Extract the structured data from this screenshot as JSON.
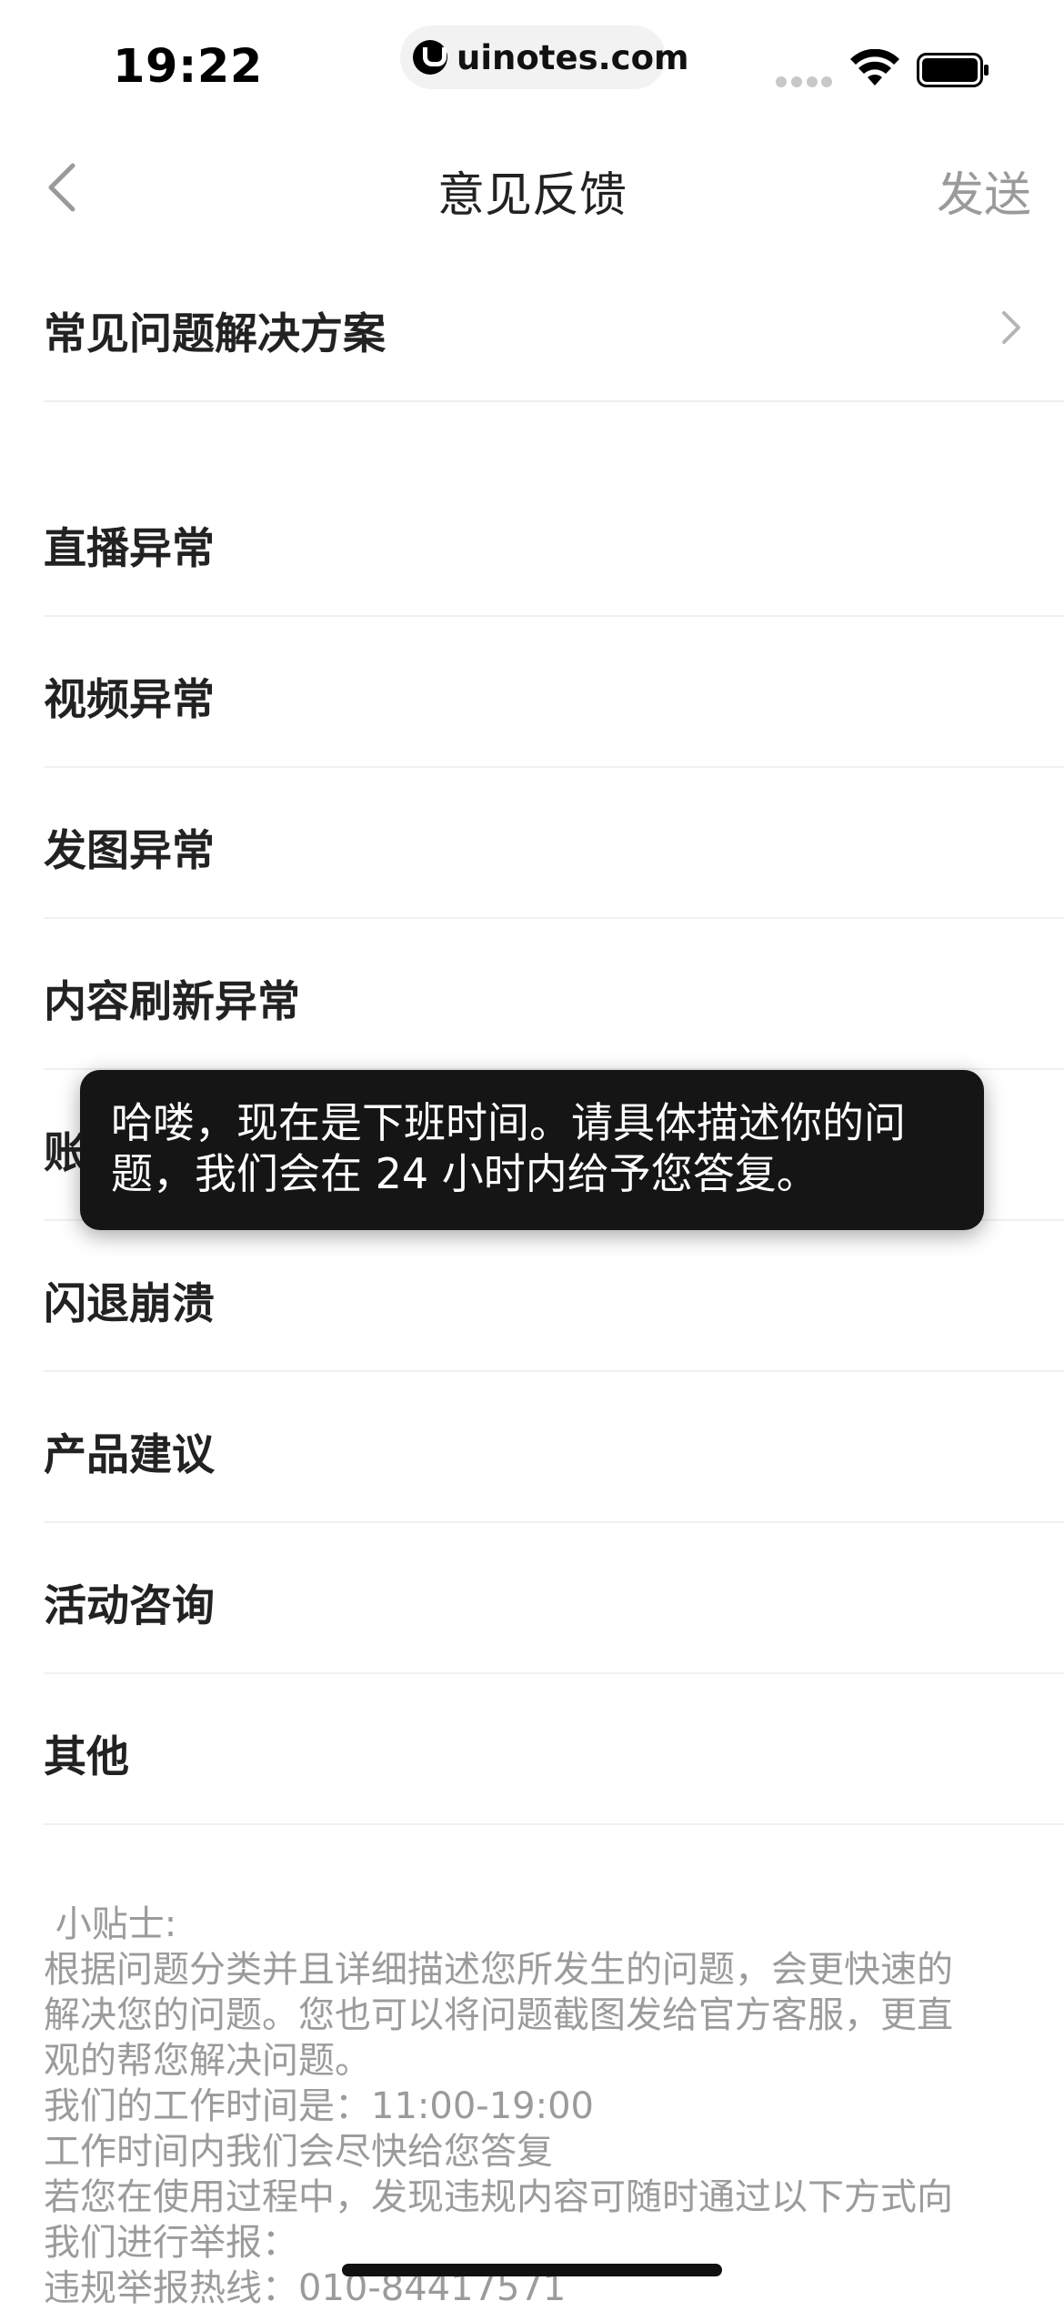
{
  "status_bar": {
    "time": "19:22",
    "url": "uinotes.com"
  },
  "nav": {
    "title": "意见反馈",
    "send_label": "发送"
  },
  "faq": {
    "label": "常见问题解决方案"
  },
  "categories": [
    {
      "label": "直播异常"
    },
    {
      "label": "视频异常"
    },
    {
      "label": "发图异常"
    },
    {
      "label": "内容刷新异常"
    },
    {
      "label": "账号异常"
    },
    {
      "label": "闪退崩溃"
    },
    {
      "label": "产品建议"
    },
    {
      "label": "活动咨询"
    },
    {
      "label": "其他"
    }
  ],
  "tips": {
    "title": " 小贴士:",
    "lines": [
      "根据问题分类并且详细描述您所发生的问题，会更快速的",
      "解决您的问题。您也可以将问题截图发给官方客服，更直",
      "观的帮您解决问题。",
      "我们的工作时间是：11:00-19:00",
      "工作时间内我们会尽快给您答复",
      "若您在使用过程中，发现违规内容可随时通过以下方式向",
      "我们进行举报：",
      "违规举报热线：010-84417571"
    ]
  },
  "toast": {
    "line1": "哈喽，现在是下班时间。请具体描述你的问",
    "line2": "题，我们会在 24 小时内给予您答复。"
  }
}
